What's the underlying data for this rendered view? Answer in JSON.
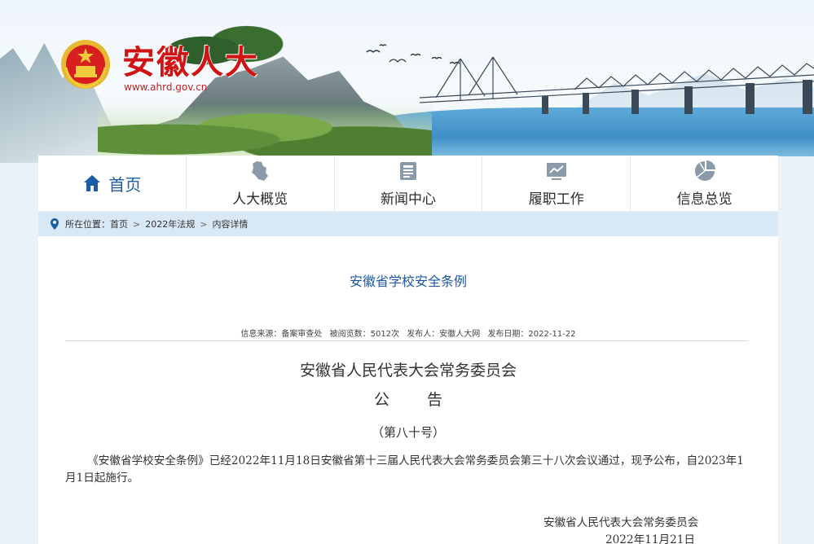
{
  "header": {
    "site_title": "安徽人大",
    "site_url": "www.ahrd.gov.cn"
  },
  "nav": {
    "items": [
      {
        "label": "首页",
        "icon": "home-icon"
      },
      {
        "label": "人大概览",
        "icon": "province-map-icon"
      },
      {
        "label": "新闻中心",
        "icon": "newspaper-icon"
      },
      {
        "label": "履职工作",
        "icon": "chart-board-icon"
      },
      {
        "label": "信息总览",
        "icon": "pie-chart-icon"
      }
    ]
  },
  "breadcrumb": {
    "prefix": "所在位置：",
    "items": [
      "首页",
      "2022年法规",
      "内容详情"
    ],
    "separator": ">"
  },
  "article": {
    "title": "安徽省学校安全条例",
    "meta": {
      "source": "信息来源：备案审查处",
      "views": "被阅览数：5012次",
      "publisher": "发布人：安徽人大网",
      "date": "发布日期：2022-11-22"
    },
    "org_heading": "安徽省人民代表大会常务委员会",
    "notice_heading": "公告",
    "number": "（第八十号）",
    "body": "《安徽省学校安全条例》已经2022年11月18日安徽省第十三届人民代表大会常务委员会第三十八次会议通过，现予公布，自2023年1月1日起施行。",
    "signature_org": "安徽省人民代表大会常务委员会",
    "signature_date": "2022年11月21日"
  },
  "colors": {
    "brand_red": "#d01414",
    "nav_active": "#1a5ea6",
    "crumb_bg": "#d9e8f5",
    "title_blue": "#1f57a4"
  }
}
